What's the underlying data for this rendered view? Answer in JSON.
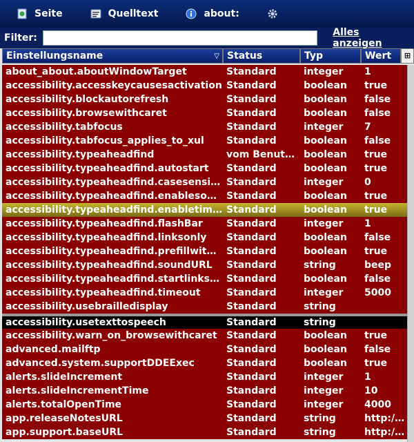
{
  "toolbar": {
    "items": [
      {
        "label": "Seite",
        "icon": "page-icon"
      },
      {
        "label": "Quelltext",
        "icon": "source-icon"
      },
      {
        "label": "about:",
        "icon": "info-icon"
      },
      {
        "label": "",
        "icon": "gear-icon"
      }
    ]
  },
  "filter": {
    "label": "Filter:",
    "value": "",
    "show_all": "Alles anzeigen"
  },
  "columns": [
    "Einstellungsname",
    "Status",
    "Typ",
    "Wert"
  ],
  "rows": [
    [
      "about_about.aboutWindowTarget",
      "Standard",
      "integer",
      "1"
    ],
    [
      "accessibility.accesskeycausesactivation",
      "Standard",
      "boolean",
      "true"
    ],
    [
      "accessibility.blockautorefresh",
      "Standard",
      "boolean",
      "false"
    ],
    [
      "accessibility.browsewithcaret",
      "Standard",
      "boolean",
      "false"
    ],
    [
      "accessibility.tabfocus",
      "Standard",
      "integer",
      "7"
    ],
    [
      "accessibility.tabfocus_applies_to_xul",
      "Standard",
      "boolean",
      "false"
    ],
    [
      "accessibility.typeaheadfind",
      "vom Benutze...",
      "boolean",
      "true"
    ],
    [
      "accessibility.typeaheadfind.autostart",
      "Standard",
      "boolean",
      "true"
    ],
    [
      "accessibility.typeaheadfind.casesensitive",
      "Standard",
      "integer",
      "0"
    ],
    [
      "accessibility.typeaheadfind.enablesound",
      "Standard",
      "boolean",
      "true"
    ],
    [
      "accessibility.typeaheadfind.enabletimeout",
      "Standard",
      "boolean",
      "true"
    ],
    [
      "accessibility.typeaheadfind.flashBar",
      "Standard",
      "integer",
      "1"
    ],
    [
      "accessibility.typeaheadfind.linksonly",
      "Standard",
      "boolean",
      "false"
    ],
    [
      "accessibility.typeaheadfind.prefillwithselec...",
      "Standard",
      "boolean",
      "true"
    ],
    [
      "accessibility.typeaheadfind.soundURL",
      "Standard",
      "string",
      "beep"
    ],
    [
      "accessibility.typeaheadfind.startlinksonly",
      "Standard",
      "boolean",
      "false"
    ],
    [
      "accessibility.typeaheadfind.timeout",
      "Standard",
      "integer",
      "5000"
    ],
    [
      "accessibility.usebrailledisplay",
      "Standard",
      "string",
      ""
    ],
    [
      "accessibility.usetexttospeech",
      "Standard",
      "string",
      ""
    ],
    [
      "accessibility.warn_on_browsewithcaret",
      "Standard",
      "boolean",
      "true"
    ],
    [
      "advanced.mailftp",
      "Standard",
      "boolean",
      "false"
    ],
    [
      "advanced.system.supportDDEExec",
      "Standard",
      "boolean",
      "true"
    ],
    [
      "alerts.slideIncrement",
      "Standard",
      "integer",
      "1"
    ],
    [
      "alerts.slideIncrementTime",
      "Standard",
      "integer",
      "10"
    ],
    [
      "alerts.totalOpenTime",
      "Standard",
      "integer",
      "4000"
    ],
    [
      "app.releaseNotesURL",
      "Standard",
      "string",
      "http://..."
    ],
    [
      "app.support.baseURL",
      "Standard",
      "string",
      "http://s..."
    ]
  ],
  "selected_row": 10,
  "black_row": 18,
  "gray_row": 17
}
